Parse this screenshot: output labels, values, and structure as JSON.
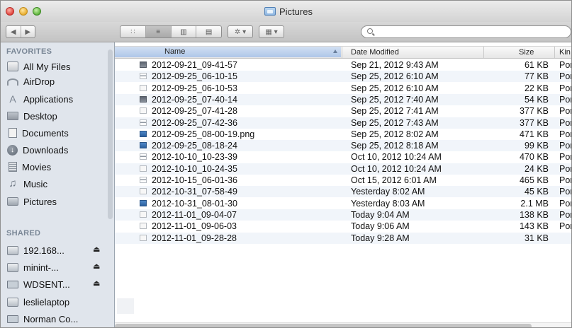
{
  "window": {
    "title": "Pictures"
  },
  "toolbar": {
    "back": "◀",
    "forward": "▶",
    "views": [
      "∷",
      "≡",
      "▥",
      "▤"
    ],
    "action": "✲ ▾",
    "arrange": "▦ ▾",
    "search_placeholder": ""
  },
  "sidebar": {
    "favorites_header": "FAVORITES",
    "favorites": [
      {
        "label": "All My Files",
        "icon": "all-files-icon"
      },
      {
        "label": "AirDrop",
        "icon": "airdrop-icon"
      },
      {
        "label": "Applications",
        "icon": "applications-icon"
      },
      {
        "label": "Desktop",
        "icon": "desktop-icon"
      },
      {
        "label": "Documents",
        "icon": "documents-icon"
      },
      {
        "label": "Downloads",
        "icon": "downloads-icon"
      },
      {
        "label": "Movies",
        "icon": "movies-icon"
      },
      {
        "label": "Music",
        "icon": "music-icon"
      },
      {
        "label": "Pictures",
        "icon": "pictures-icon"
      }
    ],
    "shared_header": "SHARED",
    "shared": [
      {
        "label": "192.168...",
        "eject": "⏏"
      },
      {
        "label": "minint-...",
        "eject": "⏏"
      },
      {
        "label": "WDSENT...",
        "eject": "⏏"
      },
      {
        "label": "leslielaptop",
        "eject": ""
      },
      {
        "label": "Norman Co...",
        "eject": ""
      }
    ]
  },
  "columns": {
    "name": "Name",
    "date": "Date Modified",
    "size": "Size",
    "kind": "Kin"
  },
  "files": [
    {
      "name": "2012-09-21_09-41-57",
      "date": "Sep 21, 2012 9:43 AM",
      "size": "61 KB",
      "kind": "Por"
    },
    {
      "name": "2012-09-25_06-10-15",
      "date": "Sep 25, 2012 6:10 AM",
      "size": "77 KB",
      "kind": "Por"
    },
    {
      "name": "2012-09-25_06-10-53",
      "date": "Sep 25, 2012 6:10 AM",
      "size": "22 KB",
      "kind": "Por"
    },
    {
      "name": "2012-09-25_07-40-14",
      "date": "Sep 25, 2012 7:40 AM",
      "size": "54 KB",
      "kind": "Por"
    },
    {
      "name": "2012-09-25_07-41-28",
      "date": "Sep 25, 2012 7:41 AM",
      "size": "377 KB",
      "kind": "Por"
    },
    {
      "name": "2012-09-25_07-42-36",
      "date": "Sep 25, 2012 7:43 AM",
      "size": "377 KB",
      "kind": "Por"
    },
    {
      "name": "2012-09-25_08-00-19.png",
      "date": "Sep 25, 2012 8:02 AM",
      "size": "471 KB",
      "kind": "Por"
    },
    {
      "name": "2012-09-25_08-18-24",
      "date": "Sep 25, 2012 8:18 AM",
      "size": "99 KB",
      "kind": "Por"
    },
    {
      "name": "2012-10-10_10-23-39",
      "date": "Oct 10, 2012 10:24 AM",
      "size": "470 KB",
      "kind": "Por"
    },
    {
      "name": "2012-10-10_10-24-35",
      "date": "Oct 10, 2012 10:24 AM",
      "size": "24 KB",
      "kind": "Por"
    },
    {
      "name": "2012-10-15_06-01-36",
      "date": "Oct 15, 2012 6:01 AM",
      "size": "465 KB",
      "kind": "Por"
    },
    {
      "name": "2012-10-31_07-58-49",
      "date": "Yesterday 8:02 AM",
      "size": "45 KB",
      "kind": "Por"
    },
    {
      "name": "2012-10-31_08-01-30",
      "date": "Yesterday 8:03 AM",
      "size": "2.1 MB",
      "kind": "Por"
    },
    {
      "name": "2012-11-01_09-04-07",
      "date": "Today 9:04 AM",
      "size": "138 KB",
      "kind": "Por"
    },
    {
      "name": "2012-11-01_09-06-03",
      "date": "Today 9:06 AM",
      "size": "143 KB",
      "kind": "Por"
    },
    {
      "name": "2012-11-01_09-28-28",
      "date": "Today 9:28 AM",
      "size": "31 KB",
      "kind": ""
    }
  ]
}
